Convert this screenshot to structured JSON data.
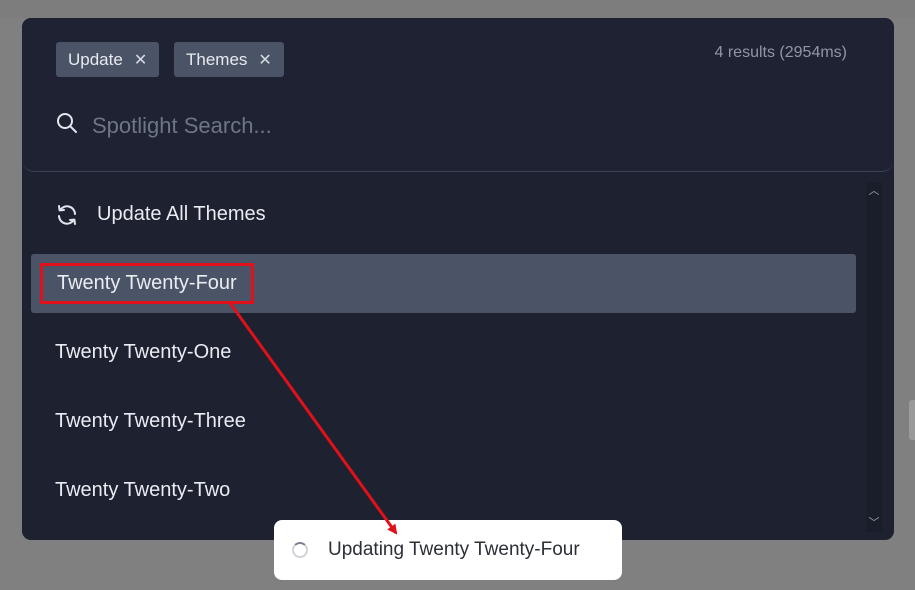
{
  "filters": {
    "chips": [
      {
        "label": "Update",
        "remove_icon": "close-icon"
      },
      {
        "label": "Themes",
        "remove_icon": "close-icon"
      }
    ]
  },
  "results_count": "4 results (2954ms)",
  "search": {
    "placeholder": "Spotlight Search...",
    "value": "",
    "icon": "search-icon"
  },
  "results": {
    "items": [
      {
        "label": "Update All Themes",
        "icon": "refresh-icon"
      },
      {
        "label": "Twenty Twenty-Four",
        "selected": true
      },
      {
        "label": "Twenty Twenty-One"
      },
      {
        "label": "Twenty Twenty-Three"
      },
      {
        "label": "Twenty Twenty-Two"
      }
    ]
  },
  "toast": {
    "text": "Updating Twenty Twenty-Four",
    "icon": "spinner-icon"
  },
  "colors": {
    "modal_bg": "#1d2130",
    "selected_bg": "#4b5467",
    "chip_bg": "#4b5466",
    "annotation": "#e0111b"
  }
}
